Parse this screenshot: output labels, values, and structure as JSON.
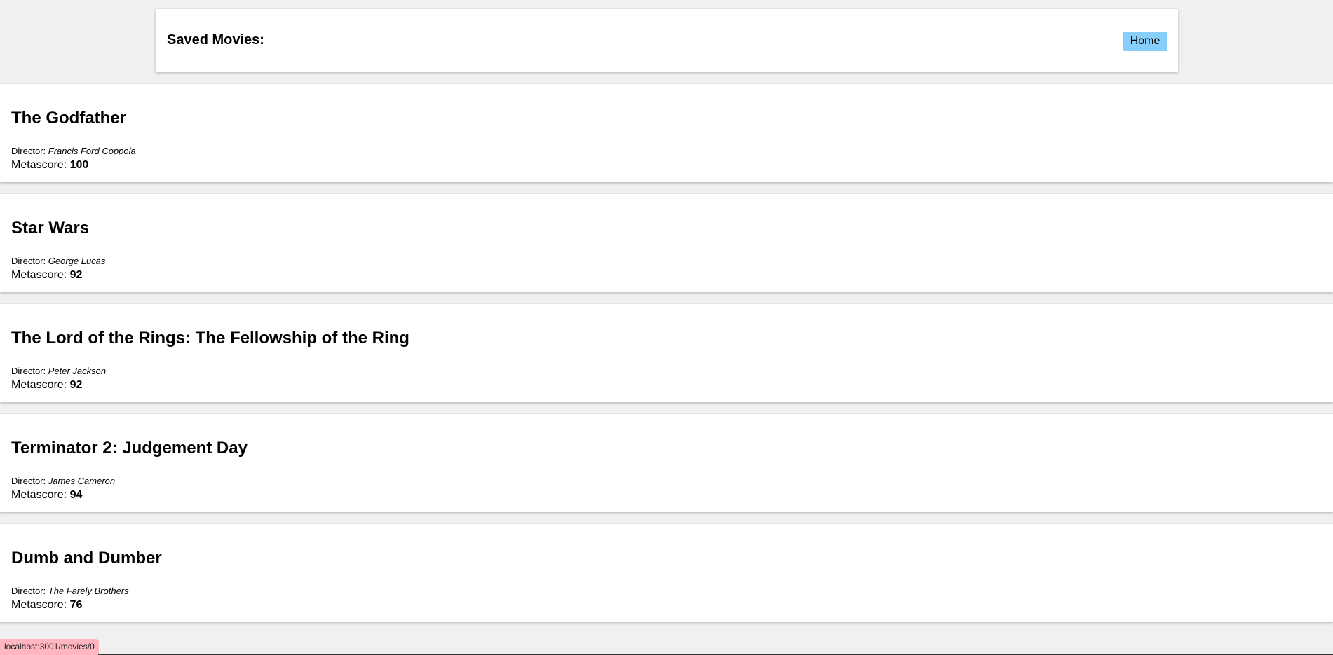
{
  "header": {
    "title": "Saved Movies:",
    "home_label": "Home",
    "home_color": "#87cefa"
  },
  "movies": [
    {
      "title": "The Godfather",
      "director_label": "Director:",
      "director": "Francis Ford Coppola",
      "metascore_label": "Metascore:",
      "metascore": "100"
    },
    {
      "title": "Star Wars",
      "director_label": "Director:",
      "director": "George Lucas",
      "metascore_label": "Metascore:",
      "metascore": "92"
    },
    {
      "title": "The Lord of the Rings: The Fellowship of the Ring",
      "director_label": "Director:",
      "director": "Peter Jackson",
      "metascore_label": "Metascore:",
      "metascore": "92"
    },
    {
      "title": "Terminator 2: Judgement Day",
      "director_label": "Director:",
      "director": "James Cameron",
      "metascore_label": "Metascore:",
      "metascore": "94"
    },
    {
      "title": "Dumb and Dumber",
      "director_label": "Director:",
      "director": "The Farely Brothers",
      "metascore_label": "Metascore:",
      "metascore": "76"
    }
  ],
  "status_bar": {
    "url": "localhost:3001/movies/0",
    "color": "#ffb6c1"
  }
}
